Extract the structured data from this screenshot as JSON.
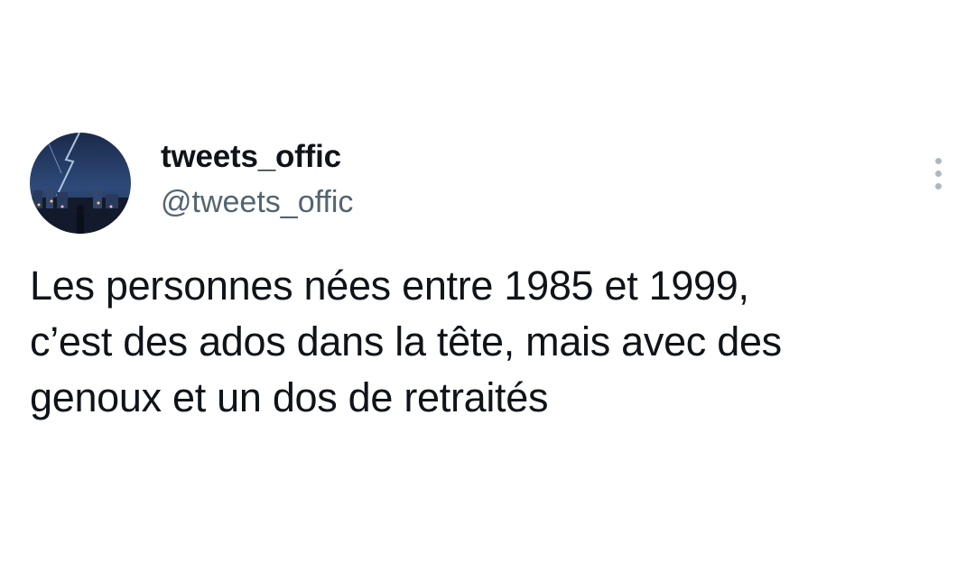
{
  "tweet": {
    "display_name": "tweets_offic",
    "handle": "@tweets_offic",
    "text": "Les personnes nées entre 1985 et 1999,\nc’est des ados dans la tête, mais avec des\ngenoux et un dos de retraités",
    "more_icon": "more-vertical-icon",
    "colors": {
      "text": "#0f1419",
      "secondary": "#536471",
      "icon": "#aab8c2",
      "background": "#ffffff"
    }
  }
}
